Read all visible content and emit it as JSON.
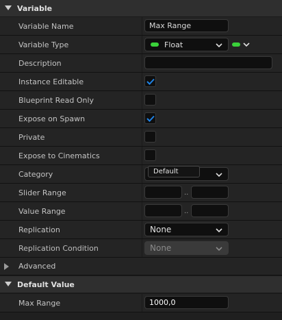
{
  "variable_section": {
    "title": "Variable",
    "rows": {
      "variable_name": {
        "label": "Variable Name",
        "value": "Max Range"
      },
      "variable_type": {
        "label": "Variable Type",
        "type_name": "Float",
        "pin_color": "#3ad13a"
      },
      "description": {
        "label": "Description",
        "value": ""
      },
      "instance_editable": {
        "label": "Instance Editable",
        "checked": true
      },
      "blueprint_read_only": {
        "label": "Blueprint Read Only",
        "checked": false
      },
      "expose_on_spawn": {
        "label": "Expose on Spawn",
        "checked": true
      },
      "private": {
        "label": "Private",
        "checked": false
      },
      "expose_to_cinematics": {
        "label": "Expose to Cinematics",
        "checked": false
      },
      "category": {
        "label": "Category",
        "value": "Default"
      },
      "slider_range": {
        "label": "Slider Range",
        "min": "",
        "max": "",
        "separator": ".."
      },
      "value_range": {
        "label": "Value Range",
        "min": "",
        "max": "",
        "separator": ".."
      },
      "replication": {
        "label": "Replication",
        "value": "None"
      },
      "replication_condition": {
        "label": "Replication Condition",
        "value": "None"
      }
    }
  },
  "advanced_section": {
    "title": "Advanced"
  },
  "default_value_section": {
    "title": "Default Value",
    "rows": {
      "max_range": {
        "label": "Max Range",
        "value": "1000,0"
      }
    }
  },
  "colors": {
    "accent": "#1f83e6",
    "float_pin": "#3ad13a"
  },
  "icons": {
    "expanded_arrow": "triangle-down-icon",
    "collapsed_arrow": "triangle-right-icon",
    "check": "check-icon",
    "dropdown": "chevron-down-icon"
  }
}
